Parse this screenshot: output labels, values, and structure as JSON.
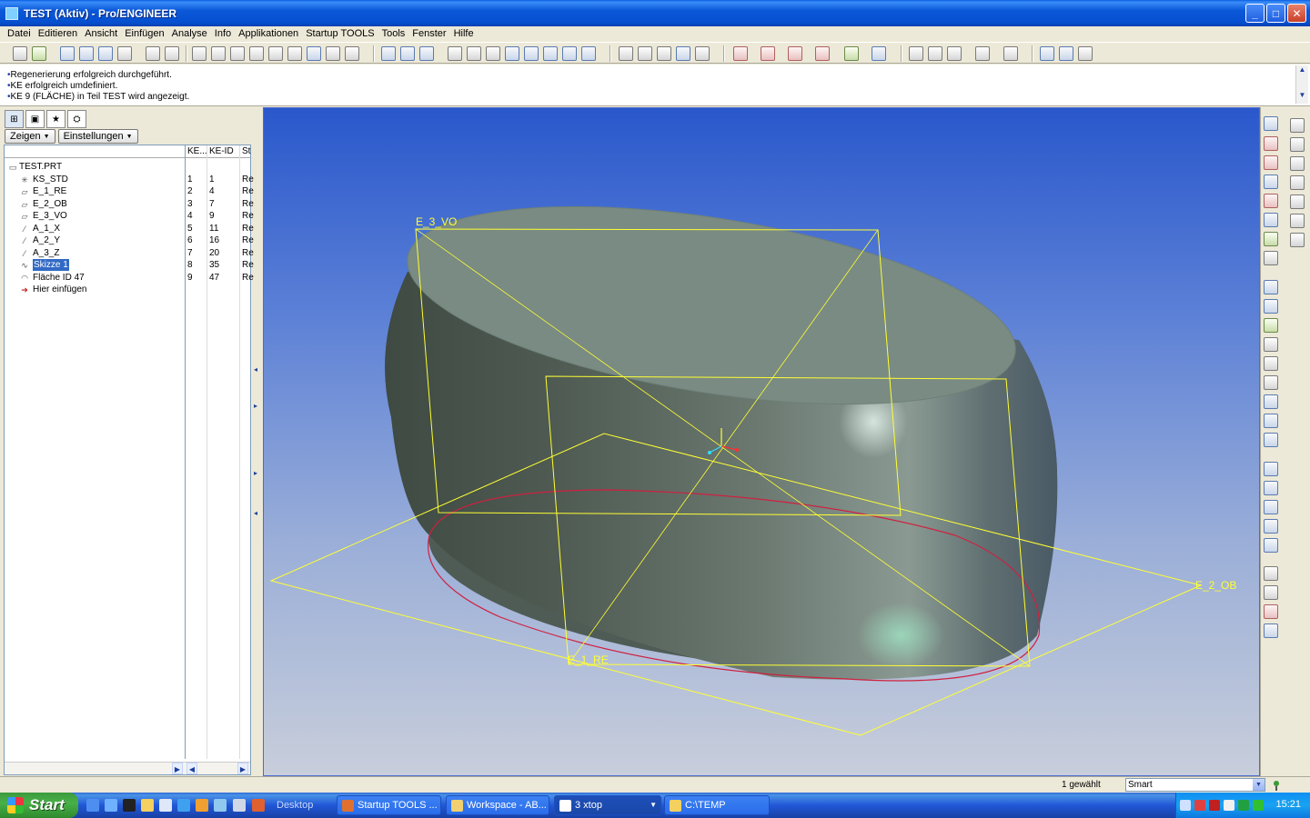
{
  "window": {
    "title": "TEST (Aktiv) - Pro/ENGINEER",
    "minimize": "_",
    "maximize": "□",
    "close": "✕"
  },
  "menu": [
    "Datei",
    "Editieren",
    "Ansicht",
    "Einfügen",
    "Analyse",
    "Info",
    "Applikationen",
    "Startup TOOLS",
    "Tools",
    "Fenster",
    "Hilfe"
  ],
  "messages": [
    "Regenerierung erfolgreich durchgeführt.",
    "KE erfolgreich umdefiniert.",
    "KE 9 (FLÄCHE) in Teil TEST wird angezeigt."
  ],
  "model_tree": {
    "buttons": {
      "show": "Zeigen",
      "settings": "Einstellungen"
    },
    "columns": [
      "KE...",
      "KE-ID",
      "St"
    ],
    "root": "TEST.PRT",
    "rows": [
      {
        "name": "KS_STD",
        "icon": "csys-icon",
        "glyph": "✳",
        "num": "1",
        "id": "1",
        "status": "Re"
      },
      {
        "name": "E_1_RE",
        "icon": "datum-plane-icon",
        "glyph": "▱",
        "num": "2",
        "id": "4",
        "status": "Re"
      },
      {
        "name": "E_2_OB",
        "icon": "datum-plane-icon",
        "glyph": "▱",
        "num": "3",
        "id": "7",
        "status": "Re"
      },
      {
        "name": "E_3_VO",
        "icon": "datum-plane-icon",
        "glyph": "▱",
        "num": "4",
        "id": "9",
        "status": "Re"
      },
      {
        "name": "A_1_X",
        "icon": "datum-axis-icon",
        "glyph": "⁄",
        "num": "5",
        "id": "11",
        "status": "Re"
      },
      {
        "name": "A_2_Y",
        "icon": "datum-axis-icon",
        "glyph": "⁄",
        "num": "6",
        "id": "16",
        "status": "Re"
      },
      {
        "name": "A_3_Z",
        "icon": "datum-axis-icon",
        "glyph": "⁄",
        "num": "7",
        "id": "20",
        "status": "Re"
      },
      {
        "name": "Skizze 1",
        "icon": "sketch-icon",
        "glyph": "∿",
        "num": "8",
        "id": "35",
        "status": "Re",
        "selected": true
      },
      {
        "name": "Fläche ID 47",
        "icon": "surface-icon",
        "glyph": "◠",
        "num": "9",
        "id": "47",
        "status": "Re"
      },
      {
        "name": "Hier einfügen",
        "icon": "insert-here-icon",
        "glyph": "➔",
        "num": "",
        "id": "",
        "status": ""
      }
    ]
  },
  "viewport": {
    "datum_labels": {
      "front": "E_3_VO",
      "top": "E_2_OB",
      "right": "E_1_RE"
    }
  },
  "status": {
    "selected": "1 gewählt",
    "filter": "Smart"
  },
  "taskbar": {
    "start": "Start",
    "desktop": "Desktop",
    "tasks": [
      "Startup TOOLS ...",
      "Workspace - AB...",
      "3 xtop",
      "C:\\TEMP"
    ],
    "clock": "15:21"
  },
  "colors": {
    "title_bar": "#0a58d8",
    "selection": "#316ac5",
    "datum": "#ffff33",
    "sketch_edge": "#d02040"
  }
}
